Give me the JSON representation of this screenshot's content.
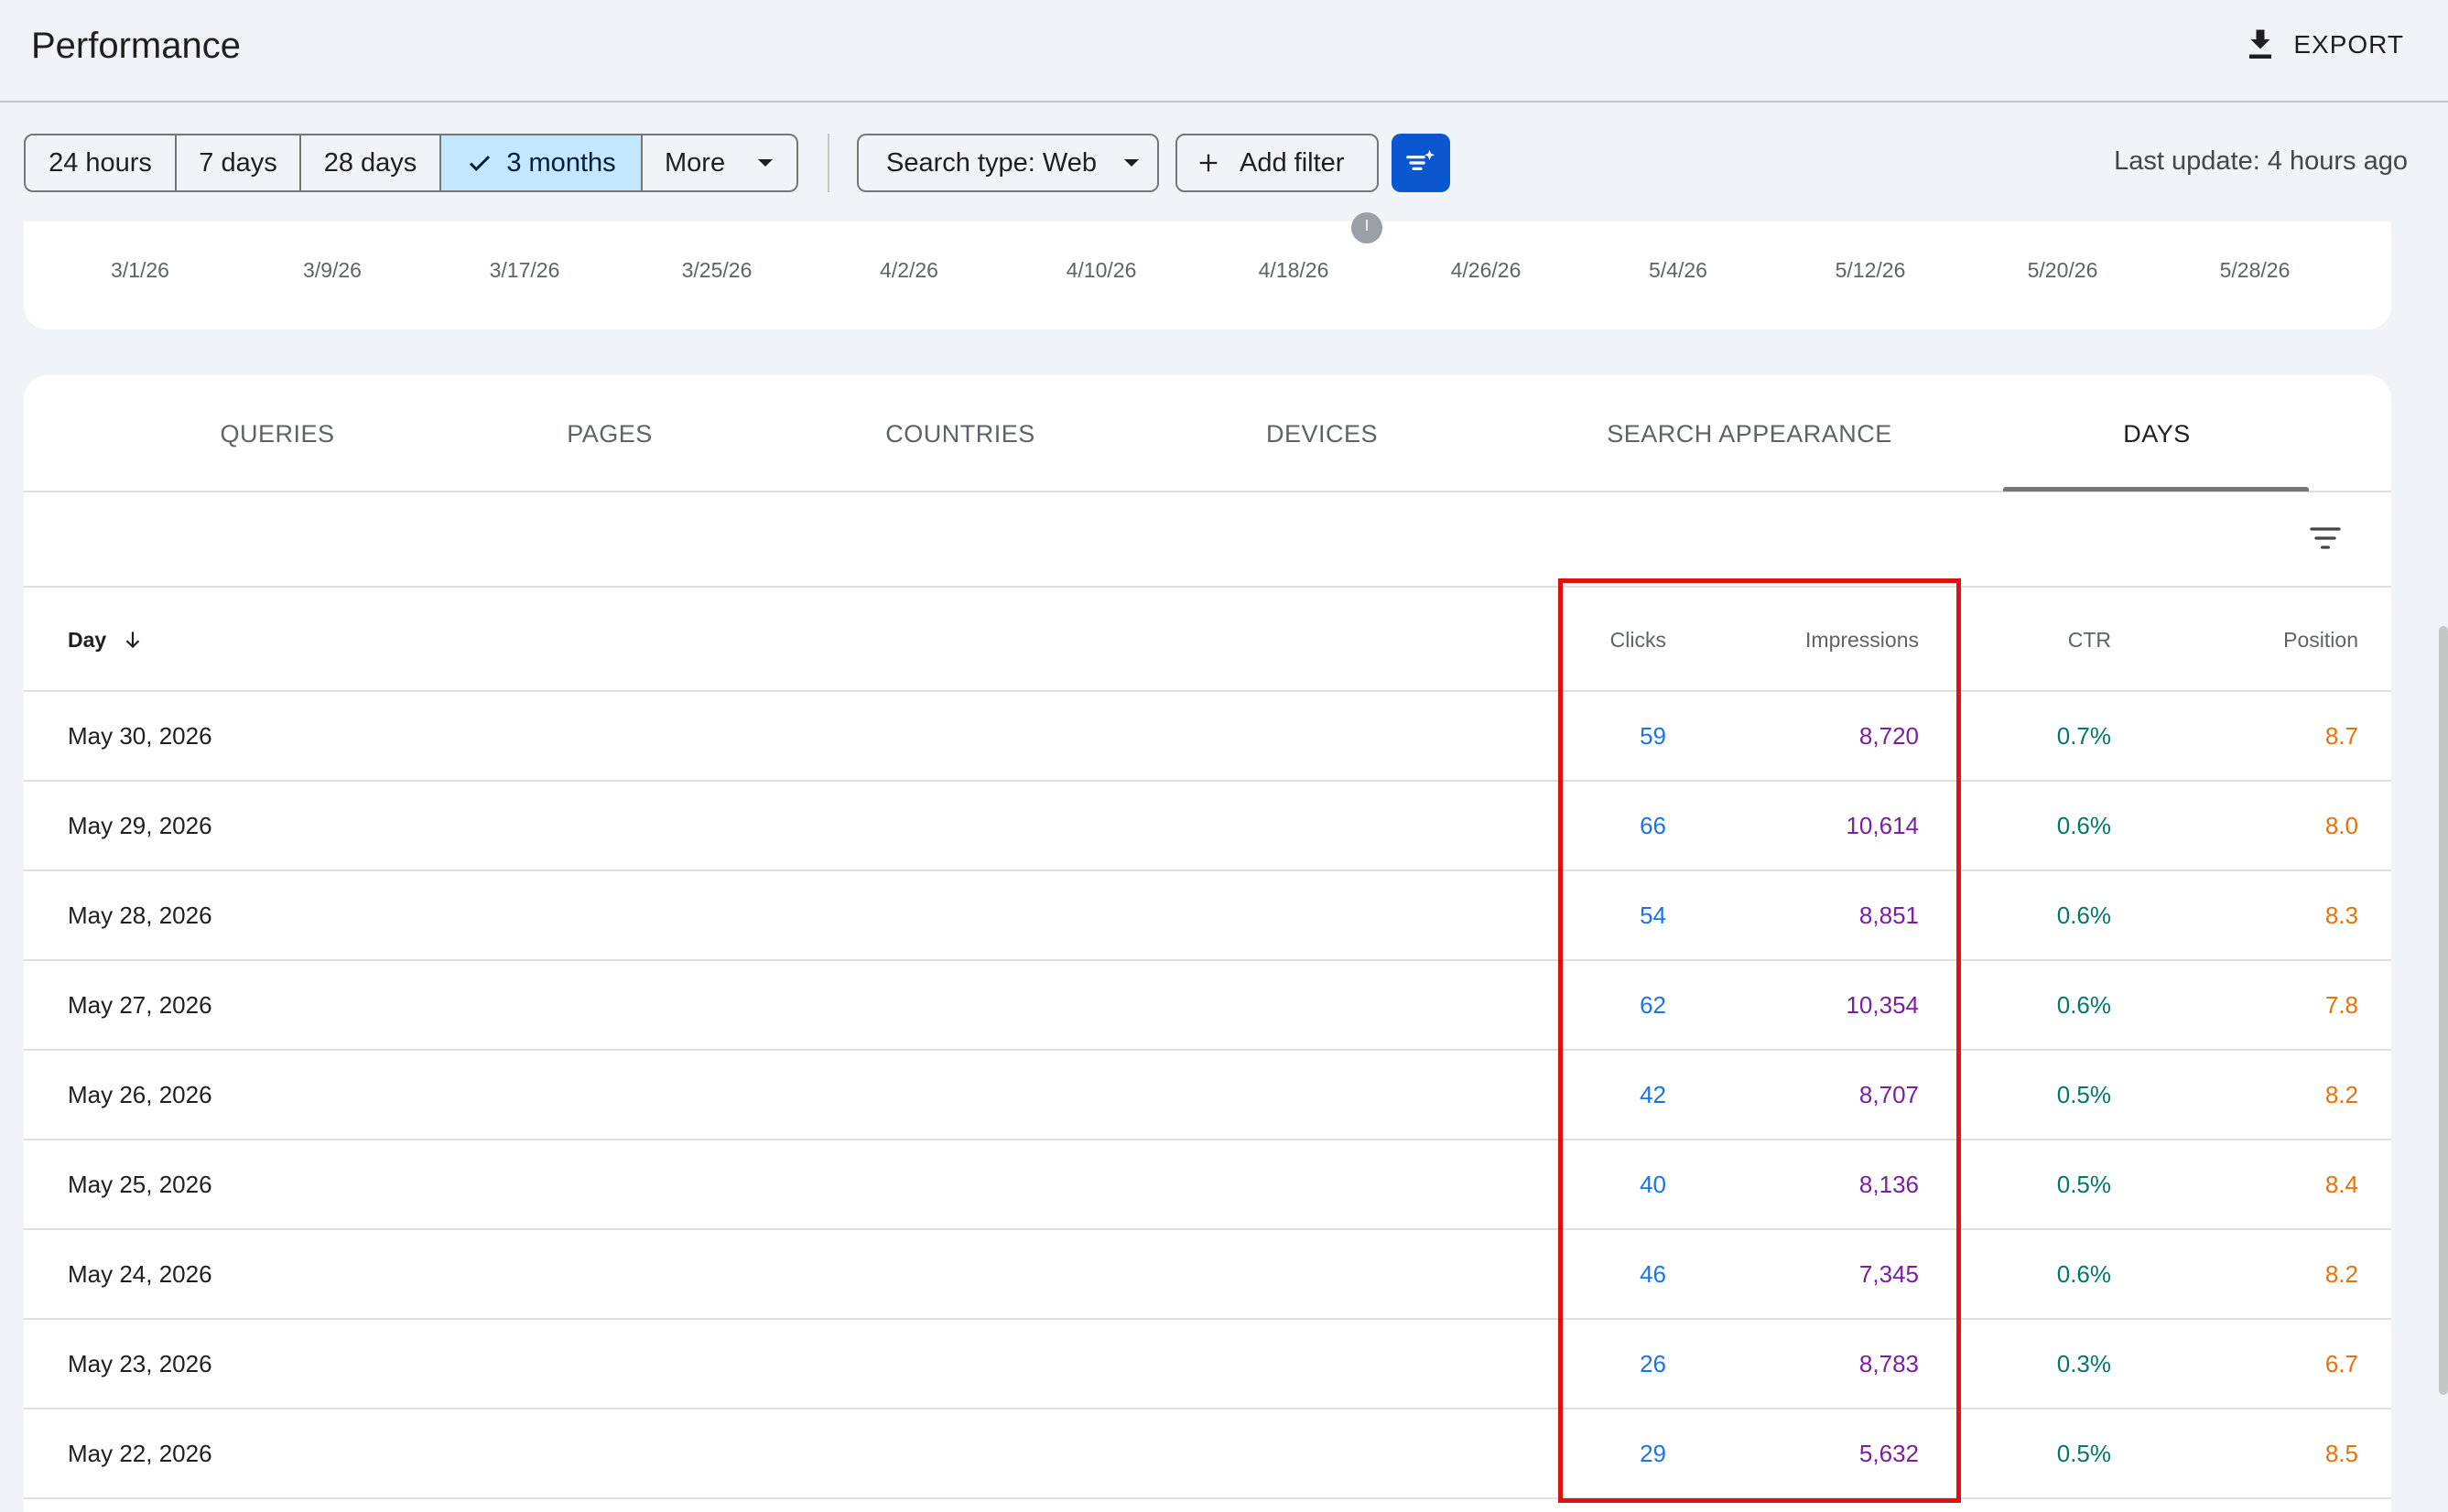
{
  "header": {
    "title": "Performance",
    "export_label": "EXPORT"
  },
  "toolbar": {
    "ranges": [
      "24 hours",
      "7 days",
      "28 days",
      "3 months",
      "More"
    ],
    "active_range": "3 months",
    "search_type": "Search type: Web",
    "add_filter": "Add filter",
    "last_update": "Last update: 4 hours ago"
  },
  "chart": {
    "date_ticks": [
      "3/1/26",
      "3/9/26",
      "3/17/26",
      "3/25/26",
      "4/2/26",
      "4/10/26",
      "4/18/26",
      "4/26/26",
      "5/4/26",
      "5/12/26",
      "5/20/26",
      "5/28/26"
    ]
  },
  "tabs": [
    "QUERIES",
    "PAGES",
    "COUNTRIES",
    "DEVICES",
    "SEARCH APPEARANCE",
    "DAYS"
  ],
  "active_tab": "DAYS",
  "table": {
    "columns": {
      "day": "Day",
      "clicks": "Clicks",
      "impressions": "Impressions",
      "ctr": "CTR",
      "position": "Position"
    },
    "rows": [
      {
        "day": "May 30, 2026",
        "clicks": "59",
        "impressions": "8,720",
        "ctr": "0.7%",
        "position": "8.7"
      },
      {
        "day": "May 29, 2026",
        "clicks": "66",
        "impressions": "10,614",
        "ctr": "0.6%",
        "position": "8.0"
      },
      {
        "day": "May 28, 2026",
        "clicks": "54",
        "impressions": "8,851",
        "ctr": "0.6%",
        "position": "8.3"
      },
      {
        "day": "May 27, 2026",
        "clicks": "62",
        "impressions": "10,354",
        "ctr": "0.6%",
        "position": "7.8"
      },
      {
        "day": "May 26, 2026",
        "clicks": "42",
        "impressions": "8,707",
        "ctr": "0.5%",
        "position": "8.2"
      },
      {
        "day": "May 25, 2026",
        "clicks": "40",
        "impressions": "8,136",
        "ctr": "0.5%",
        "position": "8.4"
      },
      {
        "day": "May 24, 2026",
        "clicks": "46",
        "impressions": "7,345",
        "ctr": "0.6%",
        "position": "8.2"
      },
      {
        "day": "May 23, 2026",
        "clicks": "26",
        "impressions": "8,783",
        "ctr": "0.3%",
        "position": "6.7"
      },
      {
        "day": "May 22, 2026",
        "clicks": "29",
        "impressions": "5,632",
        "ctr": "0.5%",
        "position": "8.5"
      }
    ]
  },
  "colors": {
    "clicks": "#1a73e8",
    "impressions": "#7b1fa2",
    "ctr": "#00796b",
    "position": "#e8710a",
    "highlight": "#e01010",
    "accent": "#0b57d0"
  }
}
